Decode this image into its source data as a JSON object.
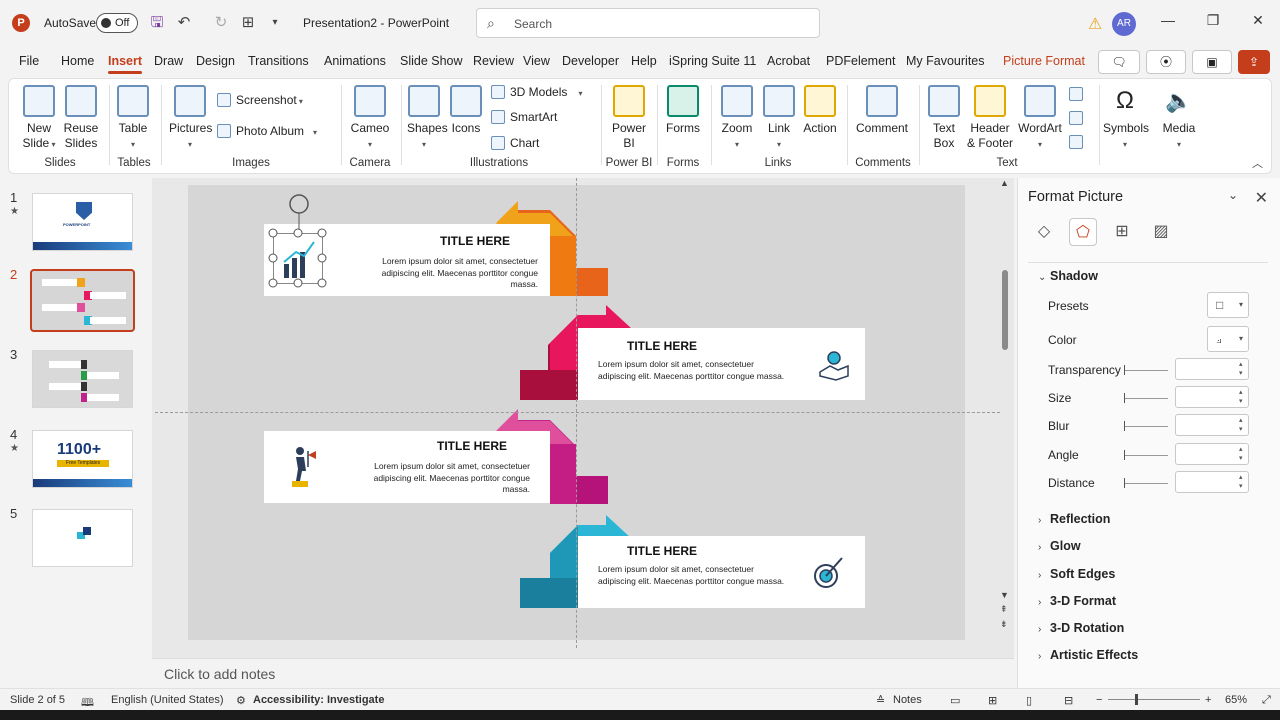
{
  "titlebar": {
    "autosave_label": "AutoSave",
    "autosave_state": "Off",
    "doc_title": "Presentation2 - PowerPoint",
    "search_placeholder": "Search",
    "avatar_initials": "AR"
  },
  "tabs": [
    "File",
    "Home",
    "Insert",
    "Draw",
    "Design",
    "Transitions",
    "Animations",
    "Slide Show",
    "Review",
    "View",
    "Developer",
    "Help",
    "iSpring Suite 11",
    "Acrobat",
    "PDFelement",
    "My Favourites",
    "Picture Format"
  ],
  "active_tab": "Insert",
  "ribbon": {
    "new_slide": [
      "New",
      "Slide"
    ],
    "reuse_slides": [
      "Reuse",
      "Slides"
    ],
    "table": "Table",
    "pictures": "Pictures",
    "screenshot": "Screenshot",
    "photo_album": "Photo Album",
    "cameo": "Cameo",
    "shapes": "Shapes",
    "icons": "Icons",
    "models_3d": "3D Models",
    "smartart": "SmartArt",
    "chart": "Chart",
    "power_bi": [
      "Power",
      "BI"
    ],
    "forms": "Forms",
    "zoom": "Zoom",
    "link": "Link",
    "action": "Action",
    "comment": "Comment",
    "text_box": [
      "Text",
      "Box"
    ],
    "header_footer": [
      "Header",
      "& Footer"
    ],
    "wordart": "WordArt",
    "symbols": "Symbols",
    "media": "Media",
    "groups": {
      "slides": "Slides",
      "tables": "Tables",
      "images": "Images",
      "camera": "Camera",
      "illustrations": "Illustrations",
      "power_bi": "Power BI",
      "forms": "Forms",
      "links": "Links",
      "comments": "Comments",
      "text": "Text"
    }
  },
  "thumbnails": [
    {
      "num": "1",
      "starred": true,
      "text": "POWERPOINT"
    },
    {
      "num": "2",
      "starred": false,
      "selected": true
    },
    {
      "num": "3",
      "starred": false
    },
    {
      "num": "4",
      "starred": true,
      "text": "1100+",
      "subtext": "Free Templates"
    },
    {
      "num": "5",
      "starred": false
    }
  ],
  "slide": {
    "steps": [
      {
        "title": "TITLE HERE",
        "body": "Lorem ipsum dolor sit amet, consectetuer adipiscing elit. Maecenas porttitor congue massa.",
        "color": "#f0a21a",
        "color_dark": "#e8641a"
      },
      {
        "title": "TITLE HERE",
        "body": "Lorem ipsum dolor sit amet, consectetuer adipiscing elit. Maecenas porttitor congue massa.",
        "color": "#e8175d",
        "color_dark": "#a80f3c"
      },
      {
        "title": "TITLE HERE",
        "body": "Lorem ipsum dolor sit amet, consectetuer adipiscing elit. Maecenas porttitor congue massa.",
        "color": "#e04f9b",
        "color_dark": "#b5127a"
      },
      {
        "title": "TITLE HERE",
        "body": "Lorem ipsum dolor sit amet, consectetuer adipiscing elit. Maecenas porttitor congue massa.",
        "color": "#2ab6d4",
        "color_dark": "#1a7f9c"
      }
    ]
  },
  "notes_placeholder": "Click to add notes",
  "format_pane": {
    "title": "Format Picture",
    "shadow": "Shadow",
    "presets": "Presets",
    "color": "Color",
    "transparency": "Transparency",
    "size": "Size",
    "blur": "Blur",
    "angle": "Angle",
    "distance": "Distance",
    "reflection": "Reflection",
    "glow": "Glow",
    "soft_edges": "Soft Edges",
    "format_3d": "3-D Format",
    "rotation_3d": "3-D Rotation",
    "artistic_effects": "Artistic Effects"
  },
  "status": {
    "slide_info": "Slide 2 of 5",
    "language": "English (United States)",
    "accessibility": "Accessibility: Investigate",
    "notes": "Notes",
    "zoom": "65%"
  }
}
